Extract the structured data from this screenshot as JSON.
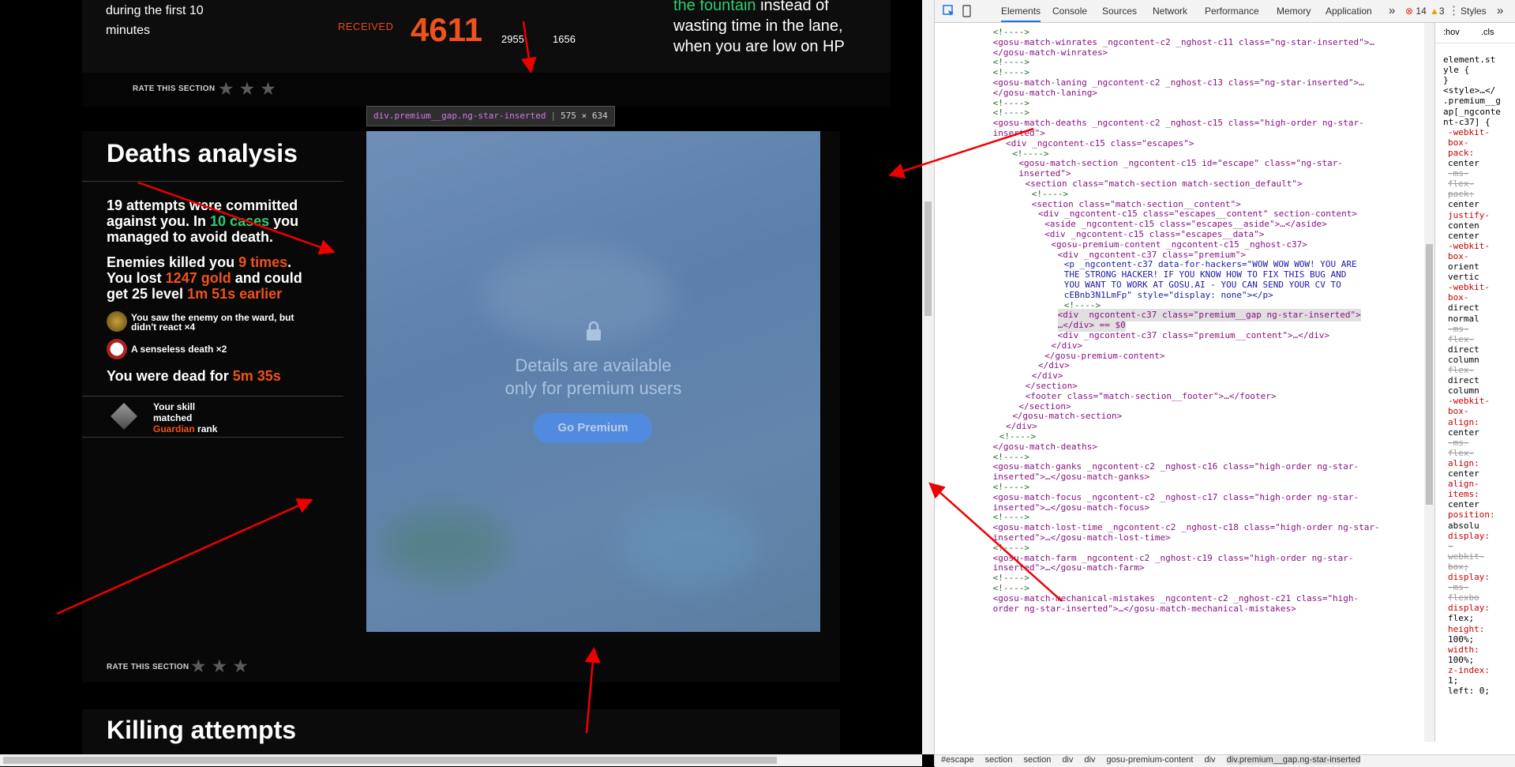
{
  "stats_section": {
    "first10_line1": "during the first 10",
    "first10_line2": "minutes",
    "received_label": "RECEIVED",
    "received_value": "4611",
    "value_a": "2955",
    "value_b": "1656",
    "tip_green": "the fountain",
    "tip_rest1": " instead of",
    "tip_rest2": "wasting time in the lane,",
    "tip_rest3": "when you are low on HP",
    "rate_label": "RATE THIS SECTION"
  },
  "deaths": {
    "title": "Deaths analysis",
    "attempts_1": "19 attempts were committed",
    "attempts_2": "against you. In ",
    "attempts_cases": "10 cases",
    "attempts_3": " you",
    "attempts_4": "managed to avoid death.",
    "killed_1": "Enemies killed you ",
    "killed_times": "9 times",
    "killed_2": ".",
    "lost_1": "You lost ",
    "lost_gold": "1247 gold",
    "lost_2": " and could",
    "level_1": "get 25 level ",
    "level_time": "1m 51s earlier",
    "ward_text_1": "You saw the enemy on the ward, but",
    "ward_text_2": "didn't react ×4",
    "senseless_text": "A senseless death ×2",
    "dead_for_1": "You were dead for ",
    "dead_for_time": "5m 35s",
    "skill_1": "Your skill",
    "skill_2": "matched",
    "skill_rank": "Guardian",
    "skill_rank_suffix": " rank",
    "rate_label": "RATE THIS SECTION"
  },
  "overlay": {
    "msg_line1": "Details are available",
    "msg_line2": "only for premium users",
    "button": "Go Premium",
    "tooltip_tag": "div.premium__gap.ng-star-inserted",
    "tooltip_size": "575 × 634"
  },
  "killing": {
    "title": "Killing attempts"
  },
  "devtools": {
    "tabs": [
      "Elements",
      "Console",
      "Sources",
      "Network",
      "Performance",
      "Memory",
      "Application"
    ],
    "more": "»",
    "errors": "14",
    "warnings": "3",
    "styles_tab": "Styles",
    "styles_more": "»",
    "hov": ":hov",
    "cls": ".cls",
    "tree": [
      "<!---->",
      "<gosu-match-winrates _ngcontent-c2 _nghost-c11 class=\"ng-star-inserted\">…",
      "</gosu-match-winrates>",
      "<!---->",
      "<!---->",
      "<gosu-match-laning _ngcontent-c2 _nghost-c13 class=\"ng-star-inserted\">…",
      "</gosu-match-laning>",
      "<!---->",
      "<!---->",
      "<gosu-match-deaths _ngcontent-c2 _nghost-c15 class=\"high-order ng-star-",
      "inserted\">",
      "<div _ngcontent-c15 class=\"escapes\">",
      "<!---->",
      "<gosu-match-section _ngcontent-c15 id=\"escape\" class=\"ng-star-",
      "inserted\">",
      "<section class=\"match-section match-section_default\">",
      "<!---->",
      "<section class=\"match-section__content\">",
      "<div _ngcontent-c15 class=\"escapes__content\" section-content>",
      "<aside _ngcontent-c15 class=\"escapes__aside\">…</aside>",
      "<div _ngcontent-c15 class=\"escapes__data\">",
      "<gosu-premium-content _ngcontent-c15 _nghost-c37>",
      "<div _ngcontent-c37 class=\"premium\">",
      "<p _ngcontent-c37 data-for-hackers=\"WOW WOW WOW! YOU ARE",
      "THE STRONG HACKER! IF YOU KNOW HOW TO FIX THIS BUG AND",
      "YOU WANT TO WORK AT GOSU.AI - YOU CAN SEND YOUR CV TO",
      "cEBnb3N1LmFp\" style=\"display: none\"></p>",
      "<!---->",
      "<div _ngcontent-c37 class=\"premium__gap ng-star-inserted\">",
      "…</div> == $0",
      "<div _ngcontent-c37 class=\"premium__content\">…</div>",
      "</div>",
      "</gosu-premium-content>",
      "</div>",
      "</div>",
      "</section>",
      "<footer class=\"match-section__footer\">…</footer>",
      "</section>",
      "</gosu-match-section>",
      "</div>",
      "<!---->",
      "</gosu-match-deaths>",
      "<!---->",
      "<gosu-match-ganks _ngcontent-c2 _nghost-c16 class=\"high-order ng-star-",
      "inserted\">…</gosu-match-ganks>",
      "<!---->",
      "<gosu-match-focus _ngcontent-c2 _nghost-c17 class=\"high-order ng-star-",
      "inserted\">…</gosu-match-focus>",
      "<!---->",
      "<gosu-match-lost-time _ngcontent-c2 _nghost-c18 class=\"high-order ng-star-",
      "inserted\">…</gosu-match-lost-time>",
      "<!---->",
      "<gosu-match-farm _ngcontent-c2 _nghost-c19 class=\"high-order ng-star-",
      "inserted\">…</gosu-match-farm>",
      "<!---->",
      "<!---->",
      "<gosu-match-mechanical-mistakes _ngcontent-c2 _nghost-c21 class=\"high-",
      "order ng-star-inserted\">…</gosu-match-mechanical-mistakes>"
    ],
    "styles": [
      "element.st",
      "yle {",
      "}",
      "<style>…</",
      ".premium__g",
      "ap[_ngconte",
      "nt-c37] {",
      "-webkit-",
      "box-",
      "pack:",
      "center",
      "-ms-",
      "flex-",
      "pack:",
      "center",
      "justify-",
      "conten",
      "center",
      "-webkit-",
      "box-",
      "orient",
      "vertic",
      "-webkit-",
      "box-",
      "direct",
      "normal",
      "-ms-",
      "flex-",
      "direct",
      "column",
      "flex-",
      "direct",
      "column",
      "-webkit-",
      "box-",
      "align:",
      "center",
      "-ms-",
      "flex-",
      "align:",
      "center",
      "align-",
      "items:",
      "center",
      "position:",
      "absolu",
      "display:",
      "-",
      "webkit-",
      "box;",
      "display:",
      "-ms-",
      "flexbo",
      "display:",
      "flex;",
      "height:",
      "100%;",
      "width:",
      "100%;",
      "z-index:",
      "1;",
      "left: 0;"
    ],
    "breadcrumb": [
      "#escape",
      "section",
      "section",
      "div",
      "div",
      "gosu-premium-content",
      "div",
      "div.premium__gap.ng-star-inserted"
    ]
  }
}
